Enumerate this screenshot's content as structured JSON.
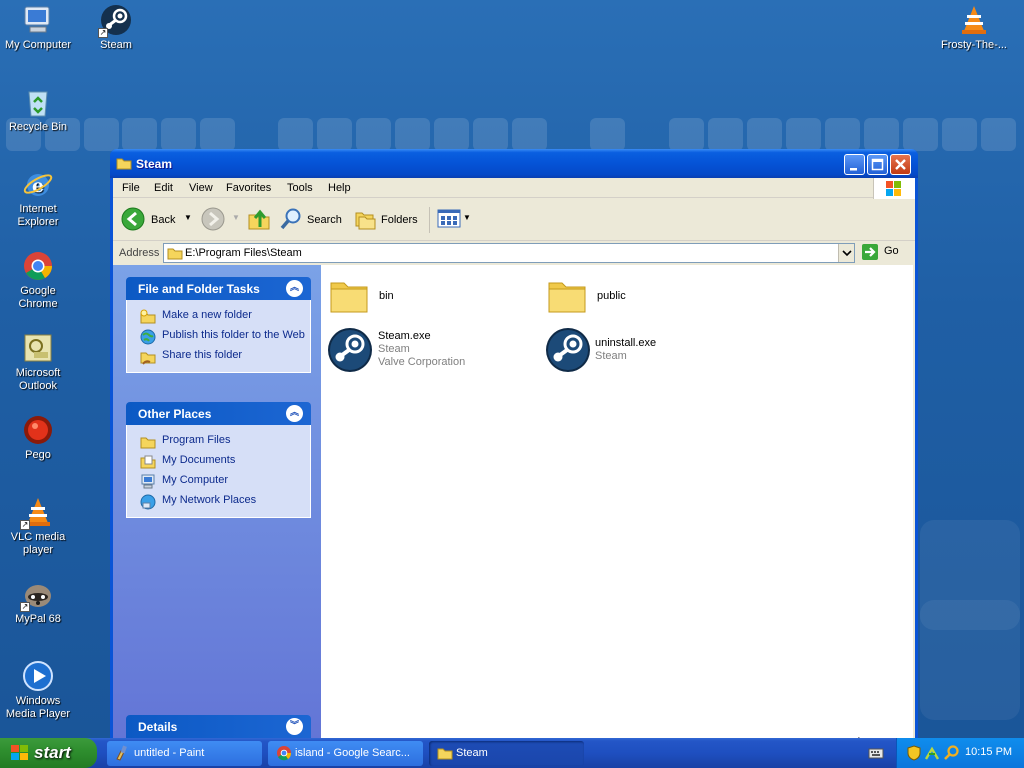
{
  "desktop": {
    "icons": [
      {
        "label": "My Computer"
      },
      {
        "label": "Steam"
      },
      {
        "label": "Frosty-The-..."
      },
      {
        "label": "Recycle Bin"
      },
      {
        "label": "Internet Explorer"
      },
      {
        "label": "Google Chrome"
      },
      {
        "label": "Microsoft Outlook"
      },
      {
        "label": "Pego"
      },
      {
        "label": "VLC media player"
      },
      {
        "label": "MyPal 68"
      },
      {
        "label": "Windows Media Player"
      }
    ]
  },
  "window": {
    "title": "Steam",
    "menu": [
      "File",
      "Edit",
      "View",
      "Favorites",
      "Tools",
      "Help"
    ],
    "toolbar": {
      "back_label": "Back",
      "search_label": "Search",
      "folders_label": "Folders"
    },
    "address": {
      "label": "Address",
      "value": "E:\\Program Files\\Steam",
      "go_label": "Go"
    },
    "taskpane": {
      "file_tasks": {
        "title": "File and Folder Tasks",
        "items": [
          "Make a new folder",
          "Publish this folder to the Web",
          "Share this folder"
        ]
      },
      "other_places": {
        "title": "Other Places",
        "items": [
          "Program Files",
          "My Documents",
          "My Computer",
          "My Network Places"
        ]
      },
      "details": {
        "title": "Details"
      }
    },
    "files": [
      {
        "name": "bin",
        "type": "folder"
      },
      {
        "name": "public",
        "type": "folder"
      },
      {
        "name": "Steam.exe",
        "line2": "Steam",
        "line3": "Valve Corporation",
        "type": "steam-app"
      },
      {
        "name": "uninstall.exe",
        "line2": "Steam",
        "type": "steam-app"
      }
    ]
  },
  "taskbar": {
    "start_label": "start",
    "tasks": [
      {
        "label": "untitled - Paint"
      },
      {
        "label": "island - Google Searc..."
      },
      {
        "label": "Steam"
      }
    ],
    "clock": "10:15 PM"
  }
}
